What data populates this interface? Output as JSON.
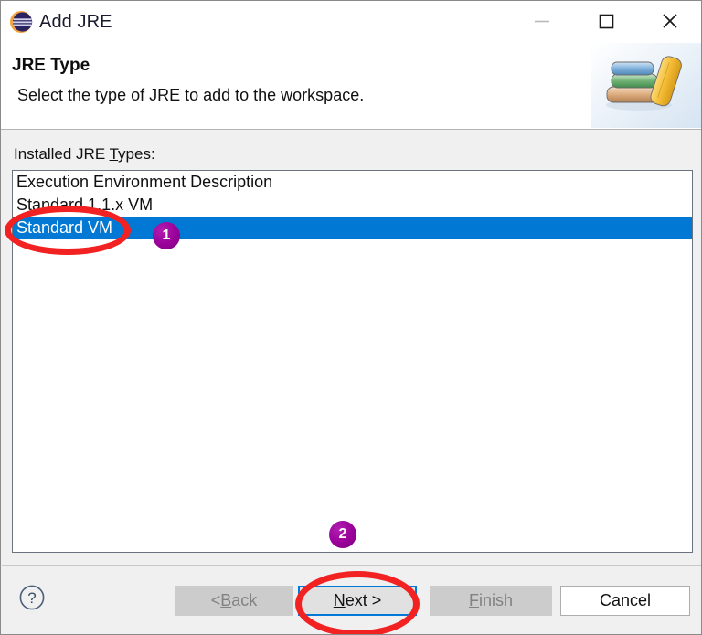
{
  "window": {
    "title": "Add JRE",
    "icon": "eclipse-logo-icon",
    "controls": {
      "minimize": "minimize-icon",
      "maximize": "maximize-icon",
      "close": "close-icon"
    }
  },
  "header": {
    "title": "JRE Type",
    "subtitle": "Select the type of JRE to add to the workspace.",
    "banner_icon": "books-stack-icon"
  },
  "main": {
    "list_label": "Installed JRE Types:",
    "list_label_prefix": "Installed JRE ",
    "list_label_mnemonic": "T",
    "list_label_suffix": "ypes:",
    "items": [
      {
        "label": "Execution Environment Description",
        "selected": false
      },
      {
        "label": "Standard 1.1.x VM",
        "selected": false
      },
      {
        "label": "Standard VM",
        "selected": true
      }
    ]
  },
  "buttons": {
    "help": "?",
    "back": {
      "label": "< Back",
      "prefix": "< ",
      "mnemonic": "B",
      "suffix": "ack",
      "state": "disabled"
    },
    "next": {
      "label": "Next >",
      "prefix": "",
      "mnemonic": "N",
      "suffix": "ext >",
      "state": "focused"
    },
    "finish": {
      "label": "Finish",
      "prefix": "",
      "mnemonic": "F",
      "suffix": "inish",
      "state": "disabled"
    },
    "cancel": {
      "label": "Cancel",
      "prefix": "Cancel",
      "mnemonic": "",
      "suffix": "",
      "state": "enabled"
    }
  },
  "annotations": {
    "badges": [
      {
        "number": "1",
        "target": "standard-vm-list-item"
      },
      {
        "number": "2",
        "target": "next-button"
      }
    ],
    "ellipses": [
      {
        "target": "standard-vm-list-item"
      },
      {
        "target": "next-button"
      }
    ],
    "highlight_color": "#f22222",
    "badge_color": "#990099"
  },
  "colors": {
    "selection_blue": "#0078d4",
    "focus_blue": "#0078d7",
    "dialog_background": "#f0f0f0"
  }
}
